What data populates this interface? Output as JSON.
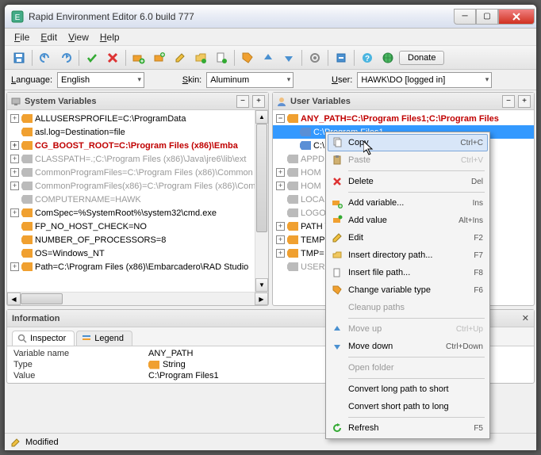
{
  "window": {
    "title": "Rapid Environment Editor 6.0 build 777"
  },
  "menu": {
    "file": "File",
    "edit": "Edit",
    "view": "View",
    "help": "Help"
  },
  "toolbar": {
    "donate": "Donate"
  },
  "filters": {
    "language_label": "Language:",
    "language_value": "English",
    "skin_label": "Skin:",
    "skin_value": "Aluminum",
    "user_label": "User:",
    "user_value": "HAWK\\DO [logged in]"
  },
  "panes": {
    "sys": {
      "title": "System Variables"
    },
    "usr": {
      "title": "User Variables"
    }
  },
  "sys_rows": [
    {
      "e": "plu",
      "dim": false,
      "bold": false,
      "t": "ALLUSERSPROFILE=C:\\ProgramData"
    },
    {
      "e": "",
      "dim": false,
      "bold": false,
      "t": "asl.log=Destination=file"
    },
    {
      "e": "plu",
      "dim": false,
      "bold": true,
      "t": "CG_BOOST_ROOT=C:\\Program Files (x86)\\Emba"
    },
    {
      "e": "plu",
      "dim": true,
      "bold": false,
      "t": "CLASSPATH=.;C:\\Program Files (x86)\\Java\\jre6\\lib\\ext"
    },
    {
      "e": "plu",
      "dim": true,
      "bold": false,
      "t": "CommonProgramFiles=C:\\Program Files (x86)\\Common"
    },
    {
      "e": "plu",
      "dim": true,
      "bold": false,
      "t": "CommonProgramFiles(x86)=C:\\Program Files (x86)\\Com"
    },
    {
      "e": "",
      "dim": true,
      "bold": false,
      "t": "COMPUTERNAME=HAWK"
    },
    {
      "e": "plu",
      "dim": false,
      "bold": false,
      "t": "ComSpec=%SystemRoot%\\system32\\cmd.exe"
    },
    {
      "e": "",
      "dim": false,
      "bold": false,
      "t": "FP_NO_HOST_CHECK=NO"
    },
    {
      "e": "",
      "dim": false,
      "bold": false,
      "t": "NUMBER_OF_PROCESSORS=8"
    },
    {
      "e": "",
      "dim": false,
      "bold": false,
      "t": "OS=Windows_NT"
    },
    {
      "e": "plu",
      "dim": false,
      "bold": false,
      "t": "Path=C:\\Program Files (x86)\\Embarcadero\\RAD Studio"
    }
  ],
  "usr_rows": [
    {
      "e": "min",
      "dim": false,
      "bold": true,
      "t": "ANY_PATH=C:\\Program Files1;C:\\Program Files",
      "ind": 0
    },
    {
      "e": "",
      "dim": false,
      "bold": false,
      "sel": true,
      "t": "C:\\Program Files1",
      "ind": 1,
      "blue": true
    },
    {
      "e": "",
      "dim": false,
      "bold": false,
      "t": "C:\\",
      "ind": 1,
      "blue": true
    },
    {
      "e": "",
      "dim": true,
      "bold": false,
      "t": "APPD",
      "ind": 0
    },
    {
      "e": "plu",
      "dim": true,
      "bold": false,
      "t": "HOM",
      "ind": 0
    },
    {
      "e": "plu",
      "dim": true,
      "bold": false,
      "t": "HOM",
      "ind": 0
    },
    {
      "e": "",
      "dim": true,
      "bold": false,
      "t": "LOCA",
      "ind": 0
    },
    {
      "e": "",
      "dim": true,
      "bold": false,
      "t": "LOGO",
      "ind": 0
    },
    {
      "e": "plu",
      "dim": false,
      "bold": false,
      "t": "PATH                                      \\Progra",
      "ind": 0
    },
    {
      "e": "plu",
      "dim": false,
      "bold": false,
      "t": "TEMP                                    %USER",
      "ind": 0
    },
    {
      "e": "plu",
      "dim": false,
      "bold": false,
      "t": "TMP=",
      "ind": 0
    },
    {
      "e": "",
      "dim": true,
      "bold": false,
      "t": "USER",
      "ind": 0
    }
  ],
  "context_menu": [
    {
      "type": "item",
      "icon": "copy",
      "label": "Copy",
      "shortcut": "Ctrl+C",
      "hov": true
    },
    {
      "type": "item",
      "icon": "paste",
      "label": "Paste",
      "shortcut": "Ctrl+V",
      "dis": true
    },
    {
      "type": "sep"
    },
    {
      "type": "item",
      "icon": "delete",
      "label": "Delete",
      "shortcut": "Del"
    },
    {
      "type": "sep"
    },
    {
      "type": "item",
      "icon": "addvar",
      "label": "Add variable...",
      "shortcut": "Ins"
    },
    {
      "type": "item",
      "icon": "addval",
      "label": "Add value",
      "shortcut": "Alt+Ins"
    },
    {
      "type": "item",
      "icon": "edit",
      "label": "Edit",
      "shortcut": "F2"
    },
    {
      "type": "item",
      "icon": "insdir",
      "label": "Insert directory path...",
      "shortcut": "F7"
    },
    {
      "type": "item",
      "icon": "insfile",
      "label": "Insert file path...",
      "shortcut": "F8"
    },
    {
      "type": "item",
      "icon": "chtype",
      "label": "Change variable type",
      "shortcut": "F6"
    },
    {
      "type": "item",
      "icon": "",
      "label": "Cleanup paths",
      "shortcut": "",
      "dis": true
    },
    {
      "type": "sep"
    },
    {
      "type": "item",
      "icon": "up",
      "label": "Move up",
      "shortcut": "Ctrl+Up",
      "dis": true
    },
    {
      "type": "item",
      "icon": "down",
      "label": "Move down",
      "shortcut": "Ctrl+Down"
    },
    {
      "type": "sep"
    },
    {
      "type": "item",
      "icon": "",
      "label": "Open folder",
      "shortcut": "",
      "dis": true
    },
    {
      "type": "sep"
    },
    {
      "type": "item",
      "icon": "",
      "label": "Convert long path to short",
      "shortcut": ""
    },
    {
      "type": "item",
      "icon": "",
      "label": "Convert short path to long",
      "shortcut": ""
    },
    {
      "type": "sep"
    },
    {
      "type": "item",
      "icon": "refresh",
      "label": "Refresh",
      "shortcut": "F5"
    }
  ],
  "info": {
    "title": "Information",
    "tab_inspector": "Inspector",
    "tab_legend": "Legend",
    "rows": [
      {
        "k": "Variable name",
        "v": "ANY_PATH"
      },
      {
        "k": "Type",
        "v": "String",
        "tag": true
      },
      {
        "k": "Value",
        "v": "C:\\Program Files1"
      }
    ]
  },
  "status": {
    "modified": "Modified"
  }
}
